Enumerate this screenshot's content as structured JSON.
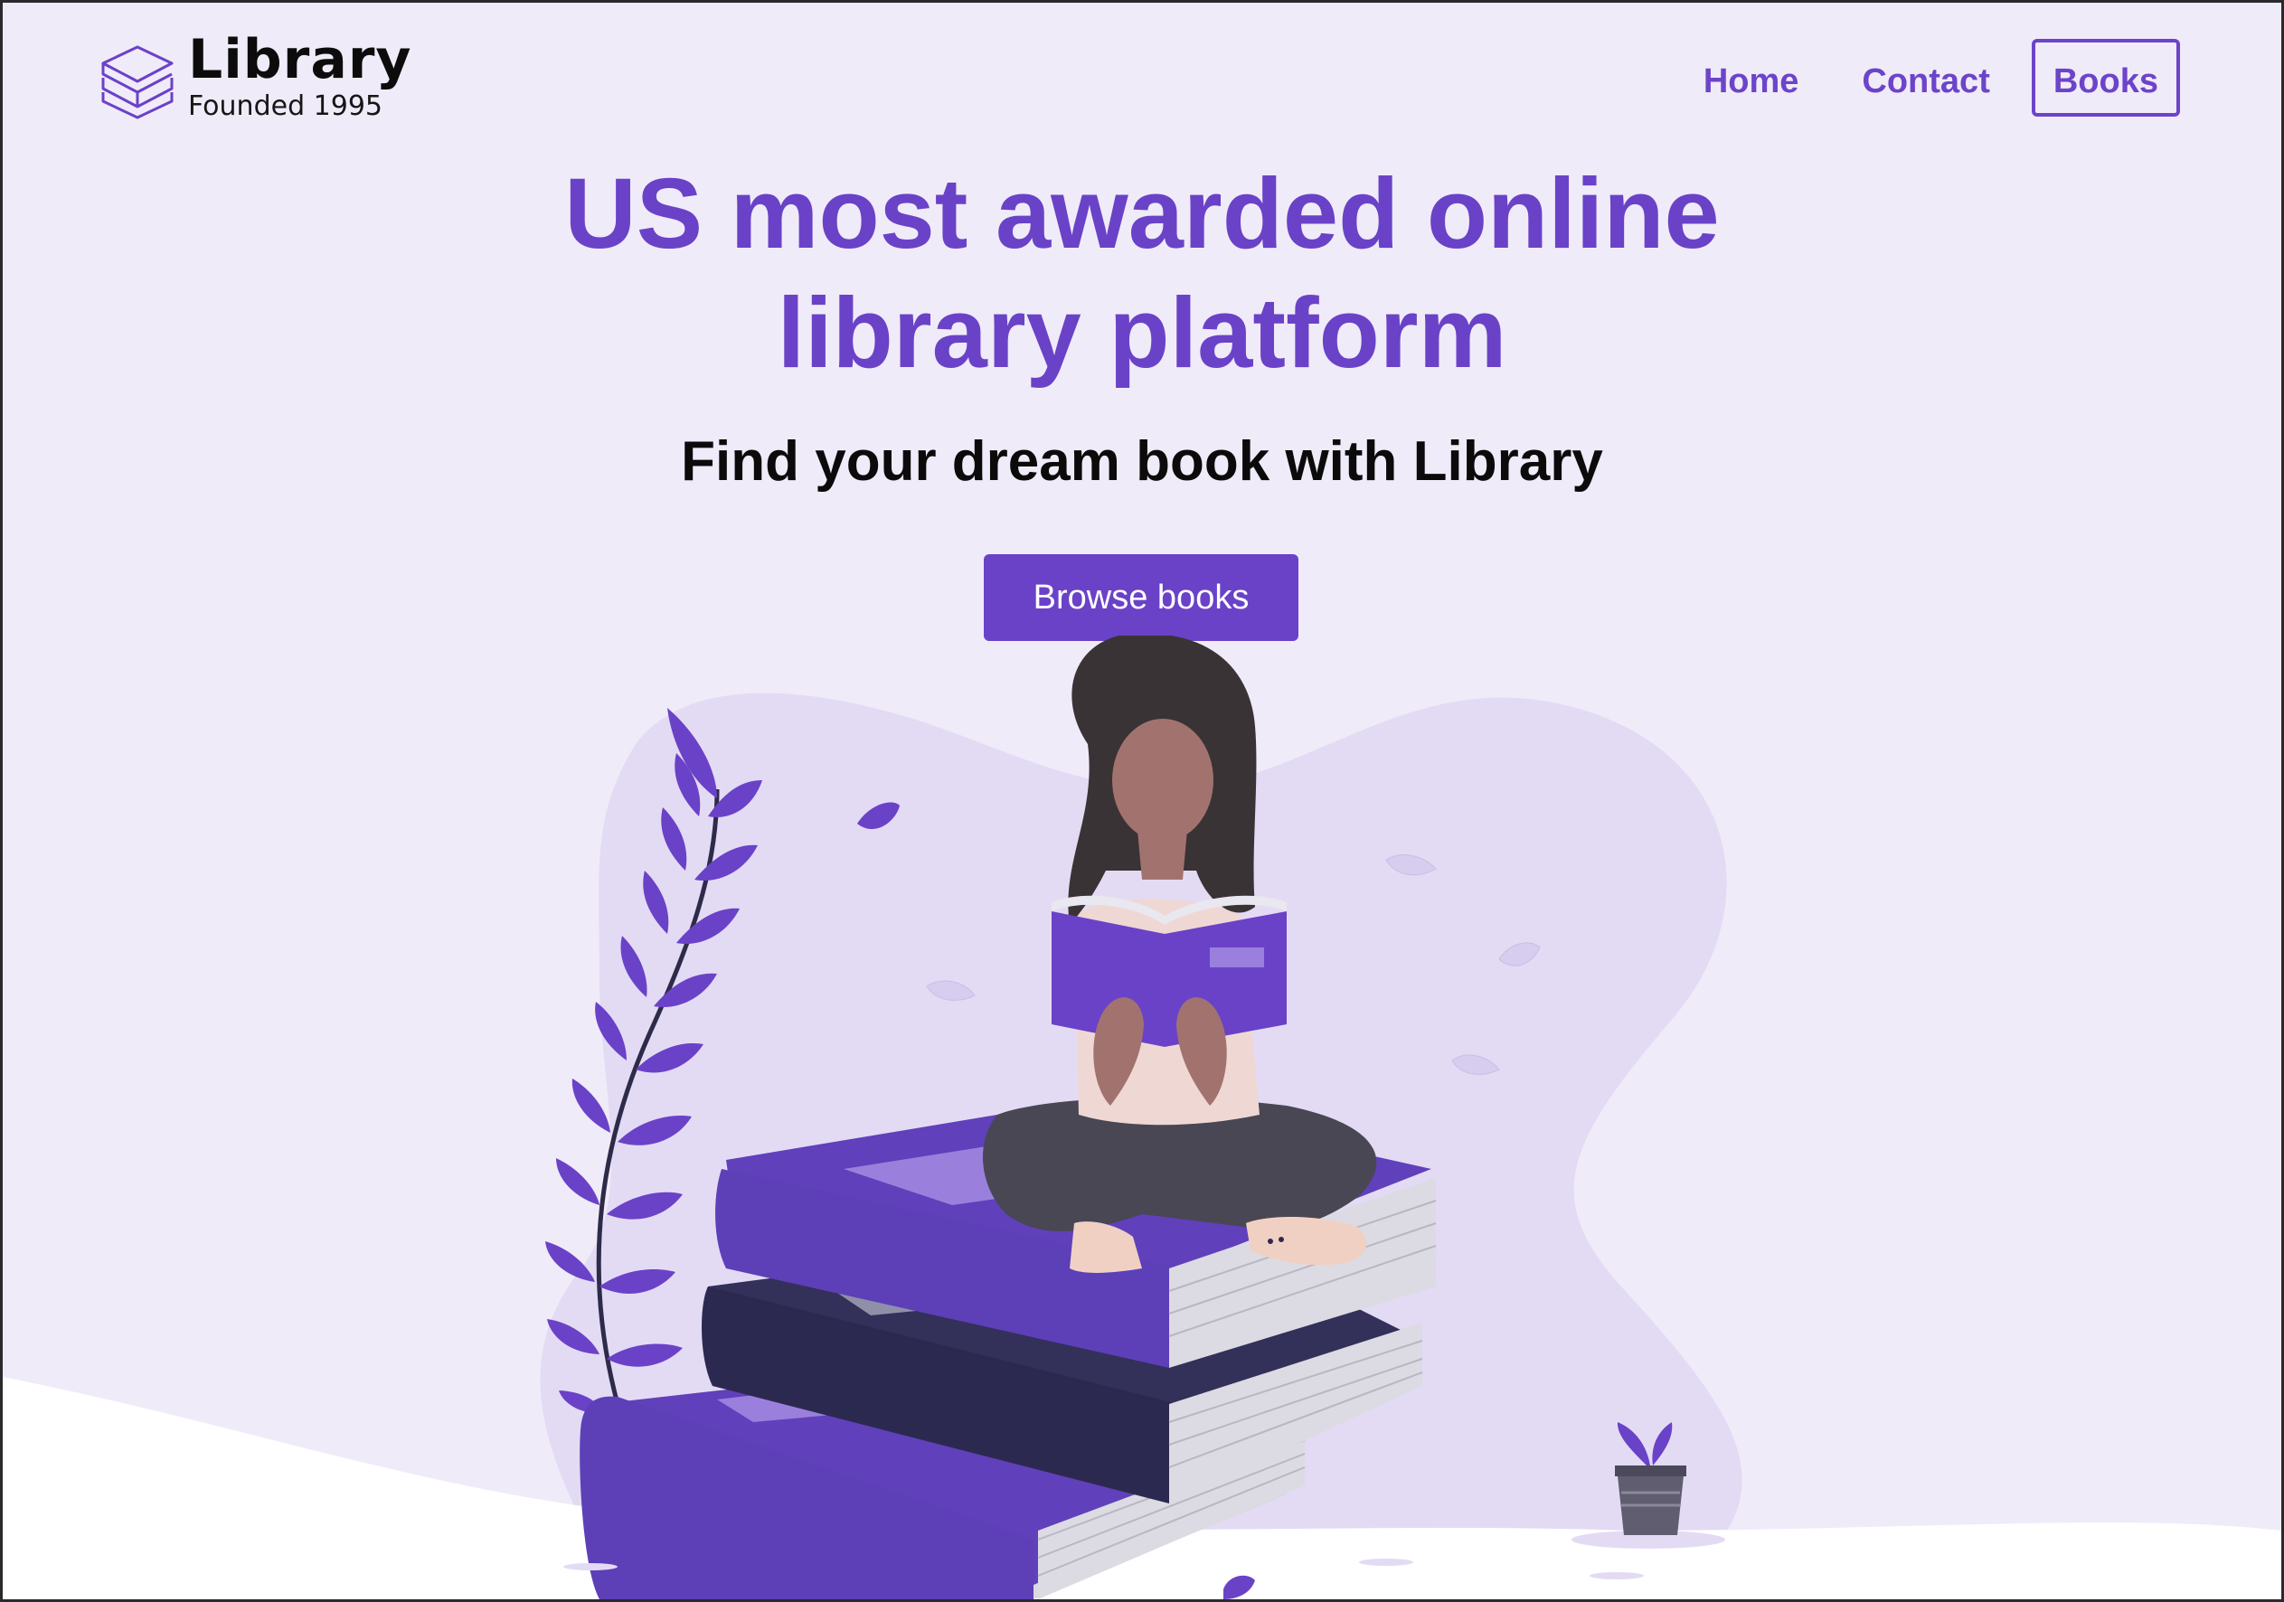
{
  "brand": {
    "name": "Library",
    "tagline": "Founded 1995",
    "icon": "stacked-books-icon"
  },
  "nav": {
    "items": [
      {
        "label": "Home",
        "active": false
      },
      {
        "label": "Contact",
        "active": false
      },
      {
        "label": "Books",
        "active": true
      }
    ]
  },
  "hero": {
    "title_line1": "US most awarded online",
    "title_line2": "library platform",
    "subtitle": "Find your dream book with Library",
    "cta_label": "Browse books",
    "illustration": "woman-reading-on-book-stack-illustration"
  },
  "colors": {
    "accent": "#6a42c8",
    "background": "#f0ebf8",
    "blob": "#e3dbf4",
    "dark_book": "#333059"
  }
}
